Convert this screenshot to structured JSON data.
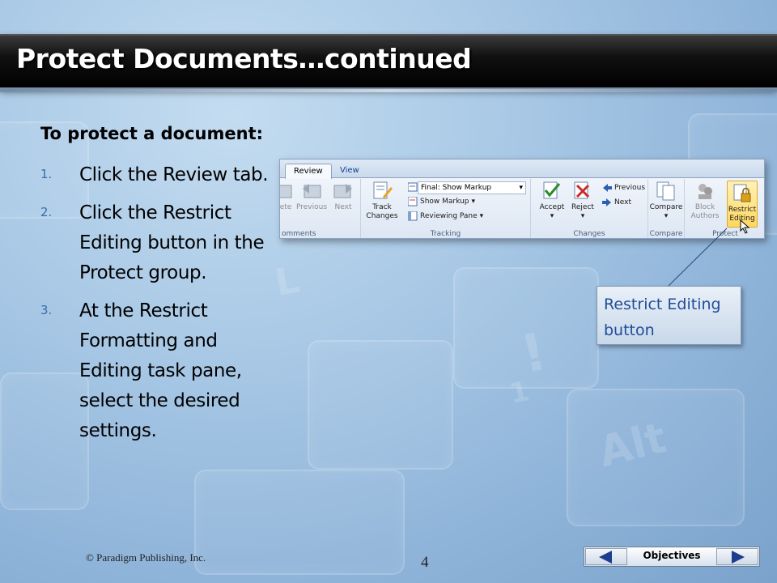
{
  "slide": {
    "title": "Protect Documents…continued",
    "heading": "To protect a document:",
    "steps": [
      {
        "num": "1.",
        "text": "Click the Review tab."
      },
      {
        "num": "2.",
        "text": "Click the Restrict Editing button in the Protect group."
      },
      {
        "num": "3.",
        "text": "At the Restrict Formatting and Editing task pane, select the desired settings."
      }
    ],
    "callout": "Restrict Editing button",
    "copyright": "© Paradigm Publishing, Inc.",
    "page_number": "4",
    "nav": {
      "objectives_label": "Objectives"
    }
  },
  "ribbon": {
    "tabs": [
      "Review",
      "View"
    ],
    "active_tab": "Review",
    "groups": {
      "comments": {
        "label": "omments",
        "buttons": [
          "ete",
          "Previous",
          "Next"
        ]
      },
      "tracking": {
        "label": "Tracking",
        "track_changes": "Track Changes",
        "markup_select": "Final: Show Markup",
        "show_markup": "Show Markup",
        "reviewing_pane": "Reviewing Pane"
      },
      "changes": {
        "label": "Changes",
        "accept": "Accept",
        "reject": "Reject",
        "previous": "Previous",
        "next": "Next"
      },
      "compare": {
        "label": "Compare",
        "compare": "Compare"
      },
      "protect": {
        "label": "Protect",
        "block_authors": "Block Authors",
        "restrict_editing": "Restrict Editing"
      }
    }
  },
  "colors": {
    "accent": "#1f4d99",
    "highlight": "#ffd75e",
    "title_bar": "#000000"
  }
}
